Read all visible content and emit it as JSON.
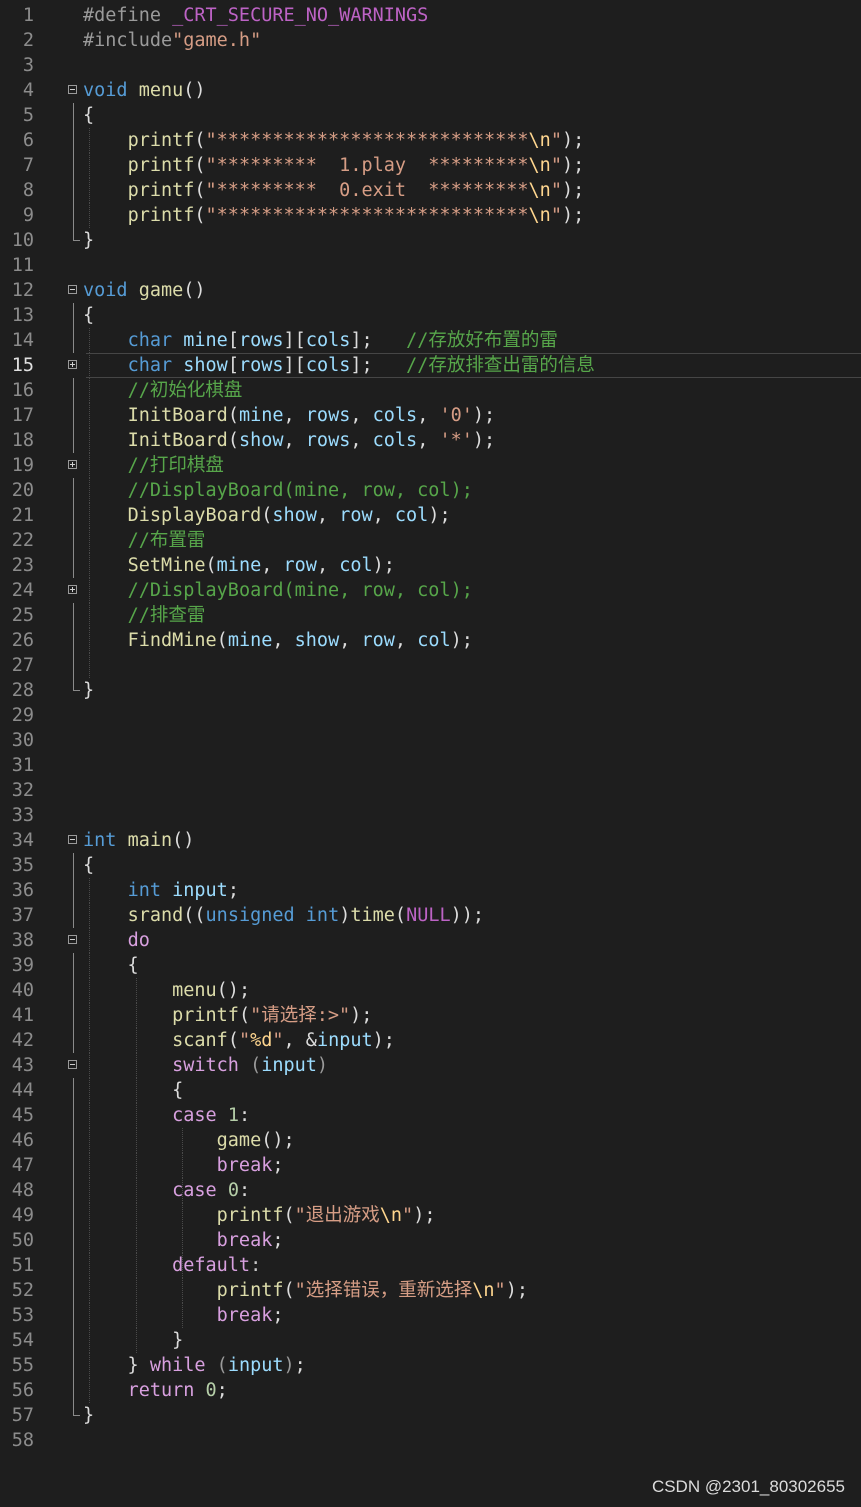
{
  "editor": {
    "language": "C",
    "current_line": 15,
    "lines": [
      [
        [
          "pp",
          "#define "
        ],
        [
          "mac",
          "_CRT_SECURE_NO_WARNINGS"
        ]
      ],
      [
        [
          "pp",
          "#include"
        ],
        [
          "str",
          "\"game.h\""
        ]
      ],
      [],
      [
        [
          "kw",
          "void"
        ],
        [
          "t",
          " "
        ],
        [
          "fn",
          "menu"
        ],
        [
          "t",
          "()"
        ]
      ],
      [
        [
          "t",
          "{"
        ]
      ],
      [
        [
          "t",
          "    "
        ],
        [
          "fn",
          "printf"
        ],
        [
          "t",
          "("
        ],
        [
          "str",
          "\"****************************"
        ],
        [
          "esc",
          "\\n"
        ],
        [
          "str",
          "\""
        ],
        [
          "t",
          ");"
        ]
      ],
      [
        [
          "t",
          "    "
        ],
        [
          "fn",
          "printf"
        ],
        [
          "t",
          "("
        ],
        [
          "str",
          "\"*********  1.play  *********"
        ],
        [
          "esc",
          "\\n"
        ],
        [
          "str",
          "\""
        ],
        [
          "t",
          ");"
        ]
      ],
      [
        [
          "t",
          "    "
        ],
        [
          "fn",
          "printf"
        ],
        [
          "t",
          "("
        ],
        [
          "str",
          "\"*********  0.exit  *********"
        ],
        [
          "esc",
          "\\n"
        ],
        [
          "str",
          "\""
        ],
        [
          "t",
          ");"
        ]
      ],
      [
        [
          "t",
          "    "
        ],
        [
          "fn",
          "printf"
        ],
        [
          "t",
          "("
        ],
        [
          "str",
          "\"****************************"
        ],
        [
          "esc",
          "\\n"
        ],
        [
          "str",
          "\""
        ],
        [
          "t",
          ");"
        ]
      ],
      [
        [
          "t",
          "}"
        ]
      ],
      [],
      [
        [
          "kw",
          "void"
        ],
        [
          "t",
          " "
        ],
        [
          "fn",
          "game"
        ],
        [
          "t",
          "()"
        ]
      ],
      [
        [
          "t",
          "{"
        ]
      ],
      [
        [
          "t",
          "    "
        ],
        [
          "kw",
          "char"
        ],
        [
          "t",
          " "
        ],
        [
          "var",
          "mine"
        ],
        [
          "t",
          "["
        ],
        [
          "var",
          "rows"
        ],
        [
          "t",
          "]["
        ],
        [
          "var",
          "cols"
        ],
        [
          "t",
          "];   "
        ],
        [
          "cm",
          "//存放好布置的雷"
        ]
      ],
      [
        [
          "t",
          "    "
        ],
        [
          "kw",
          "char"
        ],
        [
          "t",
          " "
        ],
        [
          "var",
          "show"
        ],
        [
          "t",
          "["
        ],
        [
          "var",
          "rows"
        ],
        [
          "t",
          "]["
        ],
        [
          "var",
          "cols"
        ],
        [
          "t",
          "];   "
        ],
        [
          "cm",
          "//存放排查出雷的信息"
        ]
      ],
      [
        [
          "t",
          "    "
        ],
        [
          "cm",
          "//初始化棋盘"
        ]
      ],
      [
        [
          "t",
          "    "
        ],
        [
          "fn",
          "InitBoard"
        ],
        [
          "t",
          "("
        ],
        [
          "var",
          "mine"
        ],
        [
          "t",
          ", "
        ],
        [
          "var",
          "rows"
        ],
        [
          "t",
          ", "
        ],
        [
          "var",
          "cols"
        ],
        [
          "t",
          ", "
        ],
        [
          "str",
          "'0'"
        ],
        [
          "t",
          ");"
        ]
      ],
      [
        [
          "t",
          "    "
        ],
        [
          "fn",
          "InitBoard"
        ],
        [
          "t",
          "("
        ],
        [
          "var",
          "show"
        ],
        [
          "t",
          ", "
        ],
        [
          "var",
          "rows"
        ],
        [
          "t",
          ", "
        ],
        [
          "var",
          "cols"
        ],
        [
          "t",
          ", "
        ],
        [
          "str",
          "'*'"
        ],
        [
          "t",
          ");"
        ]
      ],
      [
        [
          "t",
          "    "
        ],
        [
          "cm",
          "//打印棋盘"
        ]
      ],
      [
        [
          "t",
          "    "
        ],
        [
          "cm",
          "//DisplayBoard(mine, row, col);"
        ]
      ],
      [
        [
          "t",
          "    "
        ],
        [
          "fn",
          "DisplayBoard"
        ],
        [
          "t",
          "("
        ],
        [
          "var",
          "show"
        ],
        [
          "t",
          ", "
        ],
        [
          "var",
          "row"
        ],
        [
          "t",
          ", "
        ],
        [
          "var",
          "col"
        ],
        [
          "t",
          ");"
        ]
      ],
      [
        [
          "t",
          "    "
        ],
        [
          "cm",
          "//布置雷"
        ]
      ],
      [
        [
          "t",
          "    "
        ],
        [
          "fn",
          "SetMine"
        ],
        [
          "t",
          "("
        ],
        [
          "var",
          "mine"
        ],
        [
          "t",
          ", "
        ],
        [
          "var",
          "row"
        ],
        [
          "t",
          ", "
        ],
        [
          "var",
          "col"
        ],
        [
          "t",
          ");"
        ]
      ],
      [
        [
          "t",
          "    "
        ],
        [
          "cm",
          "//DisplayBoard(mine, row, col);"
        ]
      ],
      [
        [
          "t",
          "    "
        ],
        [
          "cm",
          "//排查雷"
        ]
      ],
      [
        [
          "t",
          "    "
        ],
        [
          "fn",
          "FindMine"
        ],
        [
          "t",
          "("
        ],
        [
          "var",
          "mine"
        ],
        [
          "t",
          ", "
        ],
        [
          "var",
          "show"
        ],
        [
          "t",
          ", "
        ],
        [
          "var",
          "row"
        ],
        [
          "t",
          ", "
        ],
        [
          "var",
          "col"
        ],
        [
          "t",
          ");"
        ]
      ],
      [],
      [
        [
          "t",
          "}"
        ]
      ],
      [],
      [],
      [],
      [],
      [],
      [
        [
          "kw",
          "int"
        ],
        [
          "t",
          " "
        ],
        [
          "fn",
          "main"
        ],
        [
          "t",
          "()"
        ]
      ],
      [
        [
          "t",
          "{"
        ]
      ],
      [
        [
          "t",
          "    "
        ],
        [
          "kw",
          "int"
        ],
        [
          "t",
          " "
        ],
        [
          "var",
          "input"
        ],
        [
          "t",
          ";"
        ]
      ],
      [
        [
          "t",
          "    "
        ],
        [
          "fn",
          "srand"
        ],
        [
          "t",
          "(("
        ],
        [
          "kw",
          "unsigned"
        ],
        [
          "t",
          " "
        ],
        [
          "kw",
          "int"
        ],
        [
          "t",
          ")"
        ],
        [
          "fn",
          "time"
        ],
        [
          "t",
          "("
        ],
        [
          "mac",
          "NULL"
        ],
        [
          "t",
          "));"
        ]
      ],
      [
        [
          "t",
          "    "
        ],
        [
          "kwc",
          "do"
        ]
      ],
      [
        [
          "t",
          "    {"
        ]
      ],
      [
        [
          "t",
          "        "
        ],
        [
          "fn",
          "menu"
        ],
        [
          "t",
          "();"
        ]
      ],
      [
        [
          "t",
          "        "
        ],
        [
          "fn",
          "printf"
        ],
        [
          "t",
          "("
        ],
        [
          "str",
          "\"请选择:>\""
        ],
        [
          "t",
          ");"
        ]
      ],
      [
        [
          "t",
          "        "
        ],
        [
          "fn",
          "scanf"
        ],
        [
          "t",
          "("
        ],
        [
          "str",
          "\""
        ],
        [
          "esc",
          "%d"
        ],
        [
          "str",
          "\""
        ],
        [
          "t",
          ", &"
        ],
        [
          "var",
          "input"
        ],
        [
          "t",
          ");"
        ]
      ],
      [
        [
          "t",
          "        "
        ],
        [
          "kwc",
          "switch"
        ],
        [
          "t",
          " "
        ],
        [
          "par",
          "("
        ],
        [
          "var",
          "input"
        ],
        [
          "par",
          ")"
        ]
      ],
      [
        [
          "t",
          "        {"
        ]
      ],
      [
        [
          "t",
          "        "
        ],
        [
          "kwc",
          "case"
        ],
        [
          "t",
          " "
        ],
        [
          "num",
          "1"
        ],
        [
          "t",
          ":"
        ]
      ],
      [
        [
          "t",
          "            "
        ],
        [
          "fn",
          "game"
        ],
        [
          "t",
          "();"
        ]
      ],
      [
        [
          "t",
          "            "
        ],
        [
          "kwc",
          "break"
        ],
        [
          "t",
          ";"
        ]
      ],
      [
        [
          "t",
          "        "
        ],
        [
          "kwc",
          "case"
        ],
        [
          "t",
          " "
        ],
        [
          "num",
          "0"
        ],
        [
          "t",
          ":"
        ]
      ],
      [
        [
          "t",
          "            "
        ],
        [
          "fn",
          "printf"
        ],
        [
          "t",
          "("
        ],
        [
          "str",
          "\"退出游戏"
        ],
        [
          "esc",
          "\\n"
        ],
        [
          "str",
          "\""
        ],
        [
          "t",
          ");"
        ]
      ],
      [
        [
          "t",
          "            "
        ],
        [
          "kwc",
          "break"
        ],
        [
          "t",
          ";"
        ]
      ],
      [
        [
          "t",
          "        "
        ],
        [
          "kwc",
          "default"
        ],
        [
          "lbl",
          ":"
        ]
      ],
      [
        [
          "t",
          "            "
        ],
        [
          "fn",
          "printf"
        ],
        [
          "t",
          "("
        ],
        [
          "str",
          "\"选择错误，重新选择"
        ],
        [
          "esc",
          "\\n"
        ],
        [
          "str",
          "\""
        ],
        [
          "t",
          ");"
        ]
      ],
      [
        [
          "t",
          "            "
        ],
        [
          "kwc",
          "break"
        ],
        [
          "t",
          ";"
        ]
      ],
      [
        [
          "t",
          "        }"
        ]
      ],
      [
        [
          "t",
          "    } "
        ],
        [
          "kwc",
          "while"
        ],
        [
          "t",
          " "
        ],
        [
          "par",
          "("
        ],
        [
          "var",
          "input"
        ],
        [
          "par",
          ")"
        ],
        [
          "t",
          ";"
        ]
      ],
      [
        [
          "t",
          "    "
        ],
        [
          "kwc",
          "return"
        ],
        [
          "t",
          " "
        ],
        [
          "num",
          "0"
        ],
        [
          "t",
          ";"
        ]
      ],
      [
        [
          "t",
          "}"
        ]
      ],
      []
    ]
  },
  "watermark": "CSDN @2301_80302655"
}
